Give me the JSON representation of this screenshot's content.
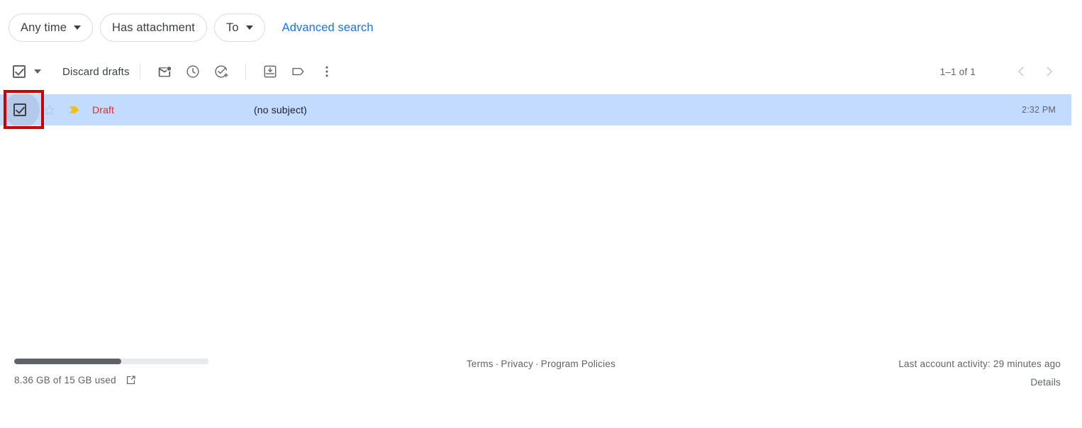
{
  "search_filters": {
    "chips": [
      {
        "label": "Any time",
        "has_caret": true,
        "icon": "chevron-down-icon"
      },
      {
        "label": "Has attachment",
        "has_caret": false,
        "icon": ""
      },
      {
        "label": "To",
        "has_caret": true,
        "icon": "chevron-down-icon"
      }
    ],
    "advanced_search_label": "Advanced search",
    "link_color": "#1a73e8"
  },
  "toolbar": {
    "select_all_icon": "checkbox-checked-icon",
    "select_all_caret_icon": "chevron-down-icon",
    "discard_drafts_label": "Discard drafts",
    "actions": [
      {
        "name": "mark-as-unread-icon",
        "title": "Mark as unread"
      },
      {
        "name": "snooze-clock-icon",
        "title": "Snooze"
      },
      {
        "name": "add-to-tasks-icon",
        "title": "Add to Tasks"
      },
      {
        "name": "move-to-inbox-icon",
        "title": "Move to Inbox"
      },
      {
        "name": "label-tag-icon",
        "title": "Labels"
      },
      {
        "name": "more-options-icon",
        "title": "More"
      }
    ],
    "pagination": {
      "range_label": "1–1 of 1",
      "prev_icon": "chevron-left-icon",
      "next_icon": "chevron-right-icon"
    }
  },
  "mail_list": {
    "rows": [
      {
        "checkbox_icon": "checkbox-checked-icon",
        "checked": true,
        "star_icon": "star-outline-icon",
        "important_icon": "important-marker-icon",
        "sender": "Draft",
        "sender_color": "#d93025",
        "subject": "(no subject)",
        "time": "2:32 PM",
        "selected_bg": "#c2dbff"
      }
    ]
  },
  "annotation": {
    "color": "#cc0000",
    "target": "row-select-checkbox"
  },
  "footer": {
    "storage": {
      "used_percent": 55,
      "text": "8.36 GB of 15 GB used",
      "external_link_icon": "external-link-icon",
      "fill_color": "#5f6368",
      "track_color": "#e8eaed"
    },
    "links": {
      "terms": "Terms",
      "privacy": "Privacy",
      "program_policies": "Program Policies",
      "separator": "·"
    },
    "account": {
      "activity_text": "Last account activity: 29 minutes ago",
      "details_label": "Details"
    }
  }
}
